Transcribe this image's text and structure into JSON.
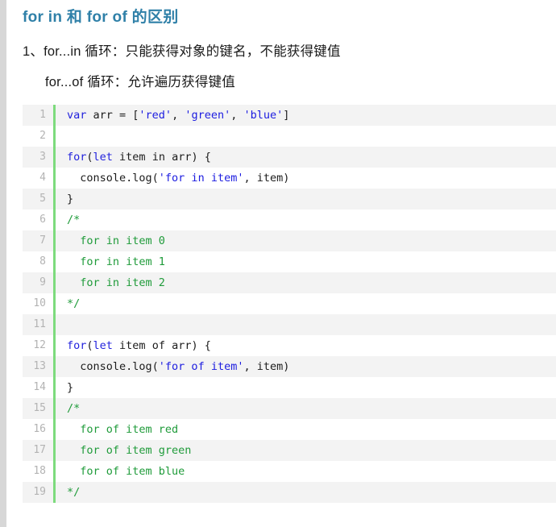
{
  "document": {
    "heading": "for in 和 for of 的区别",
    "paragraphs": [
      "1、for...in 循环：只能获得对象的键名，不能获得键值",
      "for...of 循环：允许遍历获得键值"
    ]
  },
  "colors": {
    "heading": "#2f80a8",
    "body_text": "#1a1a1a",
    "code_stripe": "#f3f3f3",
    "code_background": "#ffffff",
    "line_number": "#b3b3b3",
    "gutter_divider": "#7ddb7d",
    "keyword": "#2222dd",
    "string": "#1c1ce0",
    "comment": "#1f9b3a",
    "plain": "#1c1c1c",
    "left_strip": "#d7d7d7"
  },
  "code_block": {
    "language": "javascript",
    "lines": [
      {
        "number": "1",
        "stripe": true,
        "tokens": [
          {
            "t": "var ",
            "c": "kw"
          },
          {
            "t": "arr = [",
            "c": "plain"
          },
          {
            "t": "'red'",
            "c": "str"
          },
          {
            "t": ", ",
            "c": "plain"
          },
          {
            "t": "'green'",
            "c": "str"
          },
          {
            "t": ", ",
            "c": "plain"
          },
          {
            "t": "'blue'",
            "c": "str"
          },
          {
            "t": "]",
            "c": "plain"
          }
        ]
      },
      {
        "number": "2",
        "stripe": false,
        "tokens": []
      },
      {
        "number": "3",
        "stripe": true,
        "tokens": [
          {
            "t": "for",
            "c": "kw"
          },
          {
            "t": "(",
            "c": "plain"
          },
          {
            "t": "let",
            "c": "kw"
          },
          {
            "t": " item in arr) {",
            "c": "plain"
          }
        ]
      },
      {
        "number": "4",
        "stripe": false,
        "tokens": [
          {
            "t": "  console.log(",
            "c": "plain"
          },
          {
            "t": "'for in item'",
            "c": "str"
          },
          {
            "t": ", item)",
            "c": "plain"
          }
        ]
      },
      {
        "number": "5",
        "stripe": true,
        "tokens": [
          {
            "t": "}",
            "c": "plain"
          }
        ]
      },
      {
        "number": "6",
        "stripe": false,
        "tokens": [
          {
            "t": "/*",
            "c": "cmt"
          }
        ]
      },
      {
        "number": "7",
        "stripe": true,
        "tokens": [
          {
            "t": "  for in item 0",
            "c": "cmt"
          }
        ]
      },
      {
        "number": "8",
        "stripe": false,
        "tokens": [
          {
            "t": "  for in item 1",
            "c": "cmt"
          }
        ]
      },
      {
        "number": "9",
        "stripe": true,
        "tokens": [
          {
            "t": "  for in item 2",
            "c": "cmt"
          }
        ]
      },
      {
        "number": "10",
        "stripe": false,
        "tokens": [
          {
            "t": "*/",
            "c": "cmt"
          }
        ]
      },
      {
        "number": "11",
        "stripe": true,
        "tokens": []
      },
      {
        "number": "12",
        "stripe": false,
        "tokens": [
          {
            "t": "for",
            "c": "kw"
          },
          {
            "t": "(",
            "c": "plain"
          },
          {
            "t": "let",
            "c": "kw"
          },
          {
            "t": " item of arr) {",
            "c": "plain"
          }
        ]
      },
      {
        "number": "13",
        "stripe": true,
        "tokens": [
          {
            "t": "  console.log(",
            "c": "plain"
          },
          {
            "t": "'for of item'",
            "c": "str"
          },
          {
            "t": ", item)",
            "c": "plain"
          }
        ]
      },
      {
        "number": "14",
        "stripe": false,
        "tokens": [
          {
            "t": "}",
            "c": "plain"
          }
        ]
      },
      {
        "number": "15",
        "stripe": true,
        "tokens": [
          {
            "t": "/*",
            "c": "cmt"
          }
        ]
      },
      {
        "number": "16",
        "stripe": false,
        "tokens": [
          {
            "t": "  for of item red",
            "c": "cmt"
          }
        ]
      },
      {
        "number": "17",
        "stripe": true,
        "tokens": [
          {
            "t": "  for of item green",
            "c": "cmt"
          }
        ]
      },
      {
        "number": "18",
        "stripe": false,
        "tokens": [
          {
            "t": "  for of item blue",
            "c": "cmt"
          }
        ]
      },
      {
        "number": "19",
        "stripe": true,
        "tokens": [
          {
            "t": "*/",
            "c": "cmt"
          }
        ]
      }
    ]
  }
}
